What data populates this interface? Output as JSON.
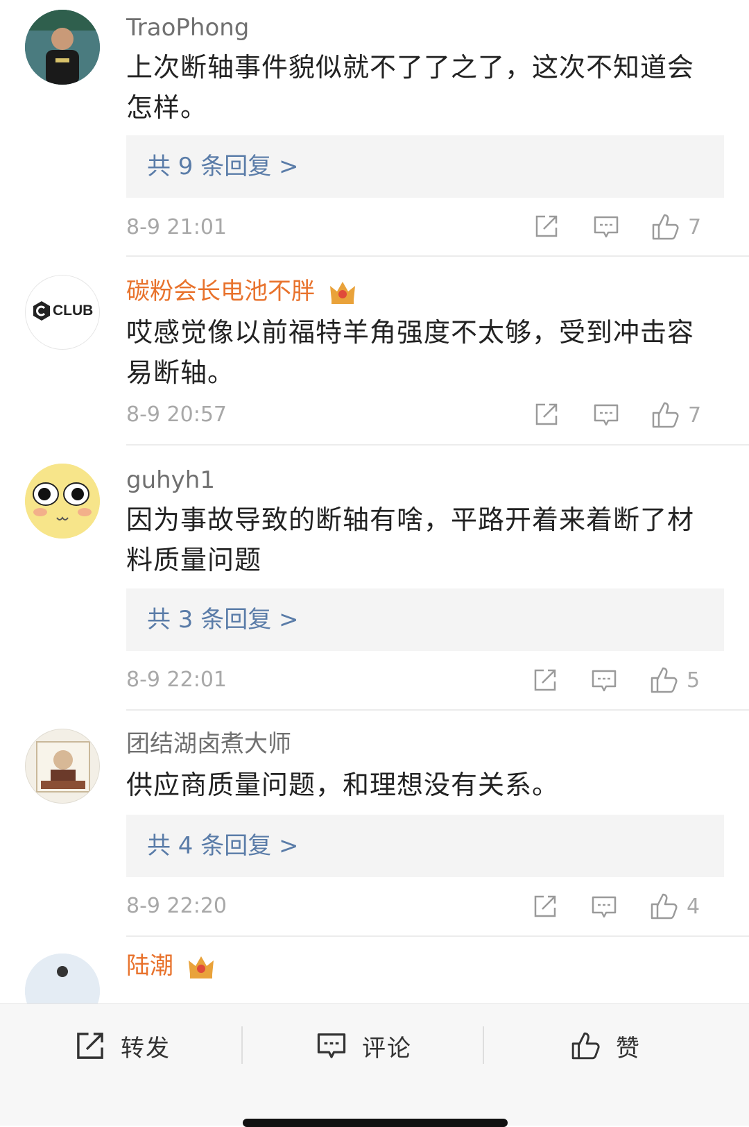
{
  "comments": [
    {
      "username": "TraoPhong",
      "text": "上次断轴事件貌似就不了了之了，这次不知道会怎样。",
      "replies": "共 9 条回复 >",
      "time": "8-9 21:01",
      "likes": "7"
    },
    {
      "username": "碳粉会长电池不胖",
      "text": "哎感觉像以前福特羊角强度不太够，受到冲击容易断轴。",
      "time": "8-9 20:57",
      "likes": "7",
      "avatar_text": "CLUB"
    },
    {
      "username": "guhyh1",
      "text": "因为事故导致的断轴有啥，平路开着来着断了材料质量问题",
      "replies": "共 3 条回复 >",
      "time": "8-9 22:01",
      "likes": "5"
    },
    {
      "username": "团结湖卤煮大师",
      "text": "供应商质量问题，和理想没有关系。",
      "replies": "共 4 条回复 >",
      "time": "8-9 22:20",
      "likes": "4"
    },
    {
      "username": "陆潮"
    }
  ],
  "bottom_bar": {
    "repost": "转发",
    "comment": "评论",
    "like": "赞"
  },
  "colors": {
    "vip_name": "#e8722c",
    "reply_link": "#5a7ca8",
    "meta": "#a8a8a8"
  },
  "icons": [
    "share-icon",
    "comment-icon",
    "thumbs-up-icon",
    "crown-icon"
  ]
}
